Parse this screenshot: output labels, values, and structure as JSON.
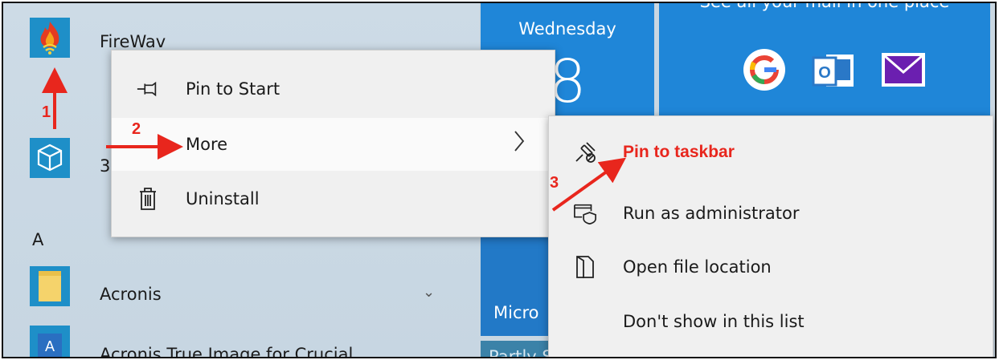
{
  "apps": [
    {
      "name": "FireWav",
      "icon": "fire-wifi-icon"
    },
    {
      "name": "3",
      "icon": "cube-icon"
    },
    {
      "name": "Acronis",
      "icon": "folder-icon"
    },
    {
      "name": "Acronis True Image for Crucial",
      "icon": "acronis-icon"
    }
  ],
  "section_letter": "A",
  "tiles": {
    "calendar": {
      "day": "Wednesday",
      "date": "8"
    },
    "mail_caption": "See all your mail in one place",
    "mail_icons": [
      "google-icon",
      "outlook-icon",
      "yahoo-mail-icon"
    ],
    "bottom_tile_label": "Micro",
    "bottom_tile2_label": "Partly Sunny"
  },
  "context_menu": {
    "items": [
      {
        "label": "Pin to Start",
        "icon": "pin-icon"
      },
      {
        "label": "More",
        "icon": "chevron-right-icon"
      },
      {
        "label": "Uninstall",
        "icon": "trash-icon"
      }
    ]
  },
  "submenu": {
    "items": [
      {
        "label": "Pin to taskbar",
        "icon": "pin-taskbar-icon"
      },
      {
        "label": "Run as administrator",
        "icon": "shield-run-icon"
      },
      {
        "label": "Open file location",
        "icon": "file-location-icon"
      },
      {
        "label": "Don't show in this list",
        "icon": ""
      }
    ]
  },
  "annotations": {
    "step1": "1",
    "step2": "2",
    "step3": "3"
  },
  "colors": {
    "annotation": "#e8261d",
    "tile_blue": "#1f86d8",
    "app_icon_blue": "#1e8fc8"
  }
}
